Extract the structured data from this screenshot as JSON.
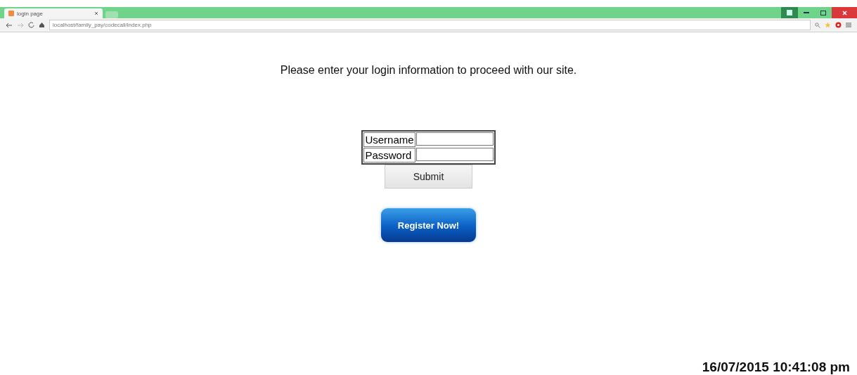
{
  "browser": {
    "tab_title": "login page",
    "address": "localhost/family_pay/codecall/index.php"
  },
  "message": "Please enter your login information to proceed with our site.",
  "form": {
    "fields": [
      {
        "label": "Username"
      },
      {
        "label": "Password"
      }
    ],
    "submit": "Submit"
  },
  "register_button": "Register Now!",
  "timestamp": "16/07/2015 10:41:08 pm"
}
